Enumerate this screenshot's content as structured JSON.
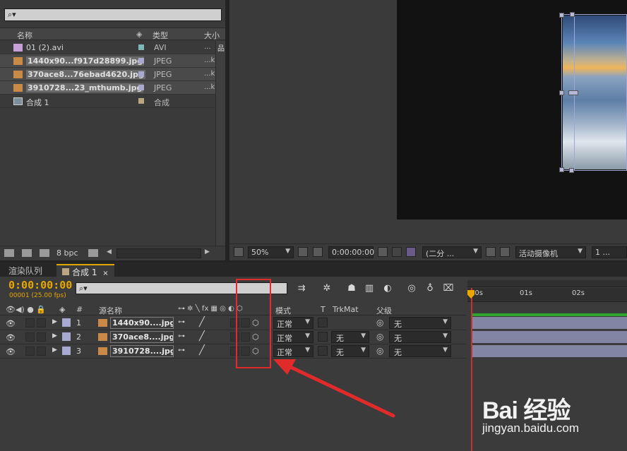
{
  "project": {
    "search_glyph": "⌕▾",
    "columns": {
      "name": "名称",
      "type": "类型",
      "size": "大小"
    },
    "items": [
      {
        "name": "01 (2).avi",
        "type": "AVI",
        "size": "...",
        "label_color": "#7fb7b7",
        "icon": "avi-file-icon",
        "selected": false
      },
      {
        "name": "1440x90...f917d28899.jpg",
        "type": "JPEG",
        "size": "...k",
        "label_color": "#a9a9cf",
        "icon": "image-file-icon",
        "selected": true
      },
      {
        "name": "370ace8...76ebad4620.jpg",
        "type": "JPEG",
        "size": "...k",
        "label_color": "#a9a9cf",
        "icon": "image-file-icon",
        "selected": true
      },
      {
        "name": "3910728...23_mthumb.jpg",
        "type": "JPEG",
        "size": "...k",
        "label_color": "#a9a9cf",
        "icon": "image-file-icon",
        "selected": true
      },
      {
        "name": "合成 1",
        "type": "合成",
        "size": "",
        "label_color": "#b9a782",
        "icon": "composition-icon",
        "selected": false
      }
    ],
    "footer": {
      "bpc": "8 bpc"
    }
  },
  "viewer": {
    "zoom": "50%",
    "timecode": "0:00:00:00",
    "resolution": "(二分 ...",
    "camera": "活动摄像机",
    "views": "1 ..."
  },
  "timeline": {
    "tabs": {
      "render_queue": "渲染队列",
      "comp": "合成 1",
      "close": "×"
    },
    "current_time": "0:00:00:00",
    "fps_info": "00001 (25.00 fps)",
    "search_glyph": "⌕▾",
    "columns": {
      "hash": "#",
      "source_name": "源名称",
      "mode": "模式",
      "t": "T",
      "trkmat": "TrkMat",
      "parent": "父级"
    },
    "layers": [
      {
        "num": "1",
        "source": "1440x90....jpg",
        "mode": "正常",
        "trkmat": "",
        "parent": "无"
      },
      {
        "num": "2",
        "source": "370ace8....jpg",
        "mode": "正常",
        "trkmat": "无",
        "parent": "无"
      },
      {
        "num": "3",
        "source": "3910728....jpg",
        "mode": "正常",
        "trkmat": "无",
        "parent": "无"
      }
    ],
    "ruler": [
      "00s",
      "01s",
      "02s"
    ]
  },
  "watermark": {
    "brand": "Bai 经验",
    "url": "jingyan.baidu.com"
  },
  "colors": {
    "accent": "#e7a700",
    "highlight_box": "#e12a2a",
    "layer_bar": "#8f93b6",
    "work_area": "#2da62d"
  }
}
